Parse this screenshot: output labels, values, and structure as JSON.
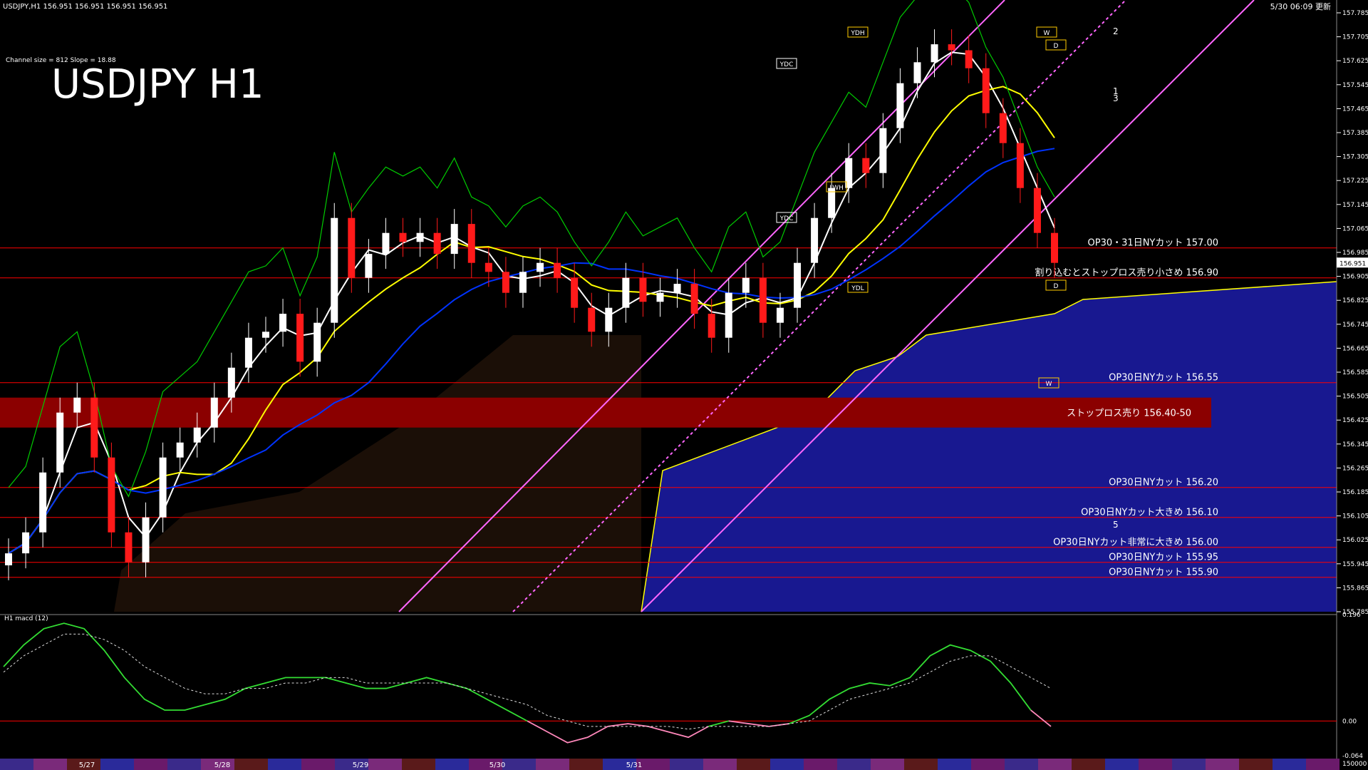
{
  "header": {
    "symbol_line": "USDJPY,H1  156.951 156.951 156.951 156.951",
    "timestamp": "5/30 06:09 更新",
    "channel_info": "Channel size = 812 Slope = 18.88",
    "big_title": "USDJPY H1"
  },
  "sub_header": "H1  macd (12)",
  "colors": {
    "background": "#000000",
    "candle_up": "#ffffff",
    "candle_down": "#ff1a1a",
    "red_line": "#ff0000",
    "stop_loss_zone": "#8b0000",
    "cloud": "#2020c0",
    "cloud_edge": "#ffff00",
    "channel": "#ff66ff",
    "ma_white": "#ffffff",
    "ma_yellow": "#ffff00",
    "ma_blue": "#0033ff",
    "chikou_green": "#00cc00",
    "macd_main": "#33dd33",
    "macd_negative": "#ff88bb",
    "macd_signal": "#dddddd"
  },
  "chart_data": {
    "type": "candlestick",
    "symbol": "USDJPY",
    "timeframe": "H1",
    "current_price": "156.951",
    "ylim": [
      155.785,
      157.785
    ],
    "y_ticks": [
      "157.785",
      "157.705",
      "157.625",
      "157.545",
      "157.465",
      "157.385",
      "157.305",
      "157.225",
      "157.145",
      "157.065",
      "156.985",
      "156.905",
      "156.825",
      "156.745",
      "156.665",
      "156.585",
      "156.505",
      "156.425",
      "156.345",
      "156.265",
      "156.185",
      "156.105",
      "156.025",
      "155.945",
      "155.865",
      "155.785"
    ],
    "date_labels": [
      "5/27",
      "5/28",
      "5/29",
      "5/30",
      "5/31"
    ],
    "trend_labels": [
      "2",
      "1",
      "3",
      "5"
    ],
    "markers": [
      "YDH",
      "YDC",
      "YDC",
      "YDL",
      "LWH",
      "W",
      "D",
      "D",
      "W"
    ],
    "ohlc_path_closes": [
      155.98,
      156.05,
      156.25,
      156.45,
      156.5,
      156.3,
      156.05,
      155.95,
      156.1,
      156.3,
      156.35,
      156.4,
      156.5,
      156.6,
      156.7,
      156.72,
      156.78,
      156.62,
      156.75,
      157.1,
      156.9,
      156.98,
      157.05,
      157.02,
      157.05,
      156.98,
      157.08,
      156.95,
      156.92,
      156.85,
      156.92,
      156.95,
      156.9,
      156.8,
      156.72,
      156.8,
      156.9,
      156.82,
      156.85,
      156.88,
      156.78,
      156.7,
      156.85,
      156.9,
      156.75,
      156.8,
      156.95,
      157.1,
      157.2,
      157.3,
      157.25,
      157.4,
      157.55,
      157.62,
      157.68,
      157.66,
      157.6,
      157.45,
      157.35,
      157.2,
      157.05,
      156.95
    ],
    "price_levels": [
      {
        "price": 157.0,
        "label": "OP30・31日NYカット 157.00"
      },
      {
        "price": 156.9,
        "label": "割り込むとストップロス売り小さめ 156.90"
      },
      {
        "price": 156.55,
        "label": "OP30日NYカット 156.55"
      },
      {
        "price": 156.2,
        "label": "OP30日NYカット 156.20"
      },
      {
        "price": 156.1,
        "label": "OP30日NYカット大きめ 156.10"
      },
      {
        "price": 156.0,
        "label": "OP30日NYカット非常に大きめ 156.00"
      },
      {
        "price": 155.95,
        "label": "OP30日NYカット 155.95"
      },
      {
        "price": 155.9,
        "label": "OP30日NYカット 155.90"
      }
    ],
    "zones": [
      {
        "from": 156.4,
        "to": 156.5,
        "label": "ストップロス売り 156.40-50"
      }
    ],
    "macd": {
      "ylim": [
        -0.064,
        0.196
      ],
      "y_ticks": [
        "0.196",
        "0.00",
        "-0.064"
      ],
      "extra_tick": "150000",
      "main": [
        0.1,
        0.14,
        0.17,
        0.18,
        0.17,
        0.13,
        0.08,
        0.04,
        0.02,
        0.02,
        0.03,
        0.04,
        0.06,
        0.07,
        0.08,
        0.08,
        0.08,
        0.07,
        0.06,
        0.06,
        0.07,
        0.08,
        0.07,
        0.06,
        0.04,
        0.02,
        0.0,
        -0.02,
        -0.04,
        -0.03,
        -0.01,
        -0.005,
        -0.01,
        -0.02,
        -0.03,
        -0.01,
        0.0,
        -0.005,
        -0.01,
        -0.005,
        0.01,
        0.04,
        0.06,
        0.07,
        0.065,
        0.08,
        0.12,
        0.14,
        0.13,
        0.11,
        0.07,
        0.02,
        -0.01
      ],
      "signal": [
        0.09,
        0.12,
        0.14,
        0.16,
        0.16,
        0.15,
        0.13,
        0.1,
        0.08,
        0.06,
        0.05,
        0.05,
        0.06,
        0.06,
        0.07,
        0.07,
        0.08,
        0.08,
        0.07,
        0.07,
        0.07,
        0.07,
        0.07,
        0.06,
        0.05,
        0.04,
        0.03,
        0.01,
        0.0,
        -0.01,
        -0.01,
        -0.01,
        -0.01,
        -0.01,
        -0.015,
        -0.01,
        -0.01,
        -0.01,
        -0.01,
        -0.005,
        0.0,
        0.02,
        0.04,
        0.05,
        0.06,
        0.07,
        0.09,
        0.11,
        0.12,
        0.12,
        0.1,
        0.08,
        0.06
      ]
    }
  }
}
